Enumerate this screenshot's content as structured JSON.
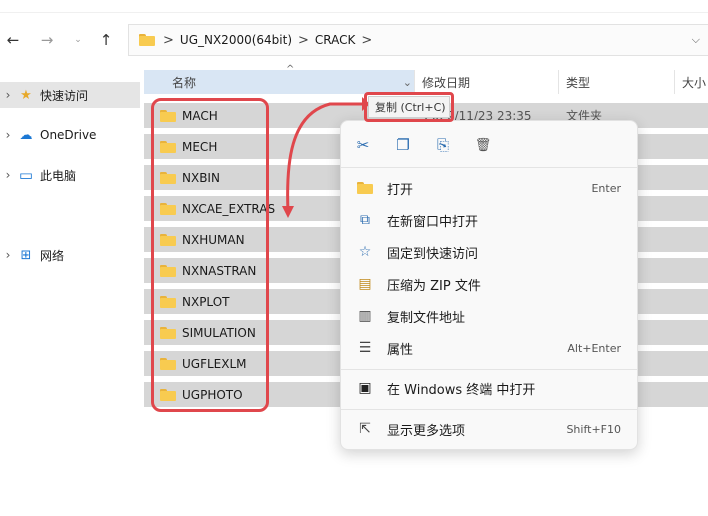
{
  "nav": {
    "back_icon": "arrow-left-icon",
    "forward_icon": "arrow-right-icon",
    "up_icon": "arrow-up-icon",
    "back": "←",
    "forward": "→",
    "up": "↑"
  },
  "address": {
    "crumbs": [
      "UG_NX2000(64bit)",
      "CRACK"
    ],
    "separator": ">",
    "dropdown": "⌵"
  },
  "sidebar": {
    "items": [
      {
        "label": "快速访问",
        "icon": "star-icon",
        "glyph": "★"
      },
      {
        "label": "OneDrive",
        "icon": "cloud-icon",
        "glyph": "☁"
      },
      {
        "label": "此电脑",
        "icon": "monitor-icon",
        "glyph": "▭"
      },
      {
        "label": "网络",
        "icon": "network-icon",
        "glyph": "⊞"
      }
    ],
    "chevron": "›"
  },
  "columns": {
    "name": "名称",
    "date": "修改日期",
    "type": "类型",
    "size": "大小"
  },
  "files": [
    {
      "name": "MACH",
      "date": "2022/11/23 23:35",
      "type": "文件夹"
    },
    {
      "name": "MECH"
    },
    {
      "name": "NXBIN"
    },
    {
      "name": "NXCAE_EXTRAS"
    },
    {
      "name": "NXHUMAN"
    },
    {
      "name": "NXNASTRAN"
    },
    {
      "name": "NXPLOT"
    },
    {
      "name": "SIMULATION"
    },
    {
      "name": "UGFLEXLM"
    },
    {
      "name": "UGPHOTO"
    }
  ],
  "tooltip": "复制 (Ctrl+C)",
  "context_menu": {
    "quick_actions": [
      {
        "icon": "cut-icon",
        "glyph": "✂"
      },
      {
        "icon": "copy-icon",
        "glyph": "❐"
      },
      {
        "icon": "rename-icon",
        "glyph": "⎘"
      },
      {
        "icon": "delete-icon",
        "glyph": "🗑"
      }
    ],
    "items": [
      {
        "label": "打开",
        "shortcut": "Enter",
        "icon": "folder-icon"
      },
      {
        "label": "在新窗口中打开",
        "shortcut": "",
        "icon": "open-new-window-icon",
        "glyph": "⧉"
      },
      {
        "label": "固定到快速访问",
        "shortcut": "",
        "icon": "pin-star-icon",
        "glyph": "☆"
      },
      {
        "label": "压缩为 ZIP 文件",
        "shortcut": "",
        "icon": "zip-icon",
        "glyph": "▤"
      },
      {
        "label": "复制文件地址",
        "shortcut": "",
        "icon": "copy-path-icon",
        "glyph": "▥"
      },
      {
        "label": "属性",
        "shortcut": "Alt+Enter",
        "icon": "properties-icon",
        "glyph": "☰"
      },
      {
        "label": "在 Windows 终端 中打开",
        "shortcut": "",
        "icon": "terminal-icon",
        "glyph": "▣"
      },
      {
        "label": "显示更多选项",
        "shortcut": "Shift+F10",
        "icon": "more-options-icon",
        "glyph": "⇱"
      }
    ]
  },
  "colors": {
    "annotation_red": "#e0474c",
    "folder_yellow": "#f8cb50",
    "row_selected": "#d6d6d6",
    "accent_blue": "#2b6cb0"
  }
}
